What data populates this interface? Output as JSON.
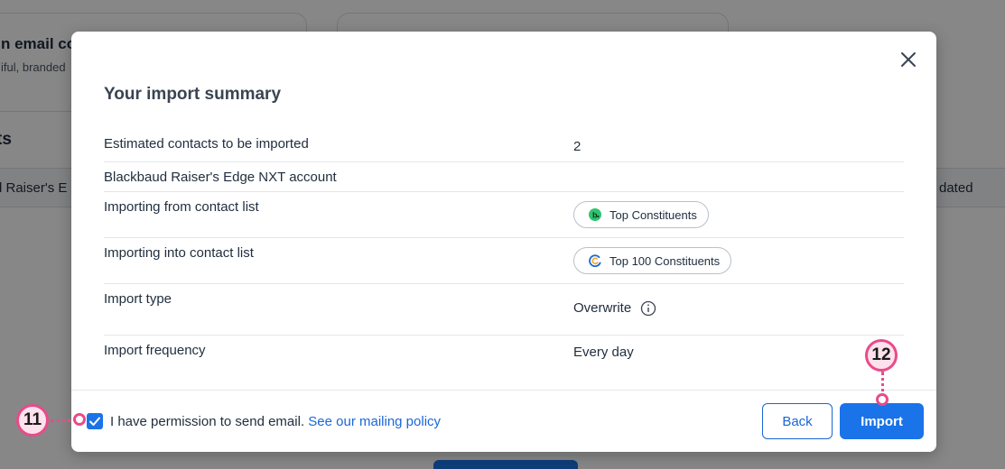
{
  "background": {
    "card1_title": "n email co",
    "card1_sub": "iful, branded",
    "section_title": "ts",
    "table_col_left": "d Raiser's E",
    "table_col_right": "dated"
  },
  "modal": {
    "title": "Your import summary",
    "close_icon": "close-icon",
    "rows": [
      {
        "label": "Estimated contacts to be imported",
        "value": "2"
      },
      {
        "label": "Blackbaud Raiser's Edge NXT account",
        "value": ""
      },
      {
        "label": "Importing from contact list",
        "chip": "Top Constituents",
        "chip_icon": "blackbaud-logo-icon"
      },
      {
        "label": "Importing into contact list",
        "chip": "Top 100 Constituents",
        "chip_icon": "constant-contact-logo-icon"
      },
      {
        "label": "Import type",
        "value": "Overwrite",
        "info_icon": "info-icon"
      },
      {
        "label": "Import frequency",
        "value": "Every day"
      }
    ],
    "footer": {
      "permission_text": "I have permission to send email.",
      "policy_link": "See our mailing policy",
      "checkbox_checked": true,
      "back_label": "Back",
      "import_label": "Import"
    }
  },
  "callouts": {
    "checkbox_step": "11",
    "import_step": "12"
  },
  "colors": {
    "accent": "#1a73e8",
    "link": "#1a66d6",
    "callout_border": "#e84b8a",
    "callout_fill": "#fde1ec"
  }
}
